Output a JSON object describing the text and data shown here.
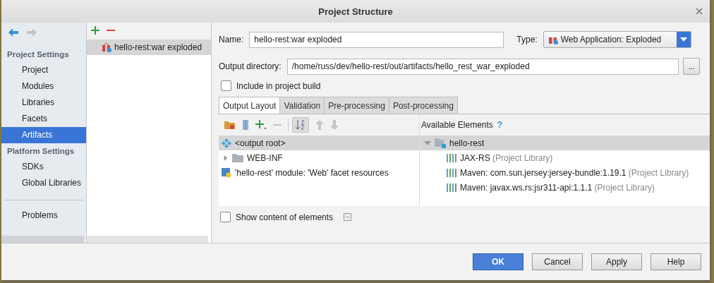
{
  "window": {
    "title": "Project Structure"
  },
  "sidebar": {
    "sections": [
      {
        "heading": "Project Settings",
        "items": [
          {
            "label": "Project",
            "selected": false
          },
          {
            "label": "Modules",
            "selected": false
          },
          {
            "label": "Libraries",
            "selected": false
          },
          {
            "label": "Facets",
            "selected": false
          },
          {
            "label": "Artifacts",
            "selected": true
          }
        ]
      },
      {
        "heading": "Platform Settings",
        "items": [
          {
            "label": "SDKs",
            "selected": false
          },
          {
            "label": "Global Libraries",
            "selected": false
          }
        ]
      }
    ],
    "footer_items": [
      {
        "label": "Problems",
        "selected": false
      }
    ]
  },
  "artifacts": {
    "items": [
      {
        "label": "hello-rest:war exploded",
        "selected": true
      }
    ]
  },
  "form": {
    "name": {
      "label": "Name:",
      "value": "hello-rest:war exploded"
    },
    "type": {
      "label": "Type:",
      "value": "Web Application: Exploded"
    },
    "output_directory": {
      "label": "Output directory:",
      "value": "/home/russ/dev/hello-rest/out/artifacts/hello_rest_war_exploded",
      "browse": "..."
    },
    "include_in_build": {
      "label": "Include in project build",
      "checked": false
    }
  },
  "tabs": [
    {
      "label": "Output Layout",
      "selected": true
    },
    {
      "label": "Validation",
      "selected": false
    },
    {
      "label": "Pre-processing",
      "selected": false
    },
    {
      "label": "Post-processing",
      "selected": false
    }
  ],
  "output_tree": [
    {
      "label": "<output root>",
      "kind": "root",
      "selected": true
    },
    {
      "label": "WEB-INF",
      "kind": "folder",
      "selected": false,
      "expanded": false
    },
    {
      "label": "'hello-rest' module: 'Web' facet resources",
      "kind": "module",
      "selected": false
    }
  ],
  "available": {
    "heading": "Available Elements",
    "help": "?",
    "items": [
      {
        "label": "hello-rest",
        "kind": "module",
        "expanded": true,
        "selected": true,
        "children": [
          {
            "label": "JAX-RS",
            "note": "(Project Library)",
            "kind": "library",
            "selected": false
          },
          {
            "label": "Maven: com.sun.jersey:jersey-bundle:1.19.1",
            "note": "(Project Library)",
            "kind": "library",
            "selected": false
          },
          {
            "label": "Maven: javax.ws.rs:jsr311-api:1.1.1",
            "note": "(Project Library)",
            "kind": "library",
            "selected": false
          }
        ]
      }
    ]
  },
  "show_content": {
    "label": "Show content of elements",
    "checked": false
  },
  "buttons": [
    {
      "label": "OK",
      "kind": "primary"
    },
    {
      "label": "Cancel",
      "kind": "default"
    },
    {
      "label": "Apply",
      "kind": "default"
    },
    {
      "label": "Help",
      "kind": "default"
    }
  ]
}
